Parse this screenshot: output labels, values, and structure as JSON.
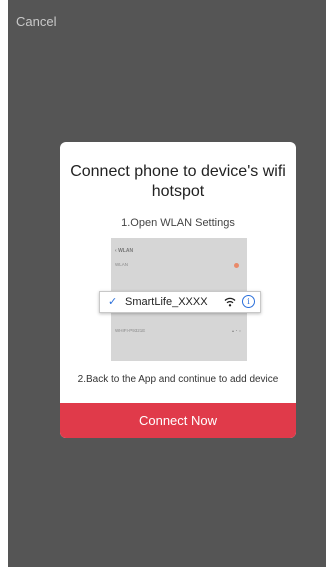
{
  "header": {
    "cancel_label": "Cancel"
  },
  "modal": {
    "title": "Connect phone to device's wifi hotspot",
    "step1": "1.Open WLAN Settings",
    "step2": "2.Back to the App and continue to add device",
    "connect_label": "Connect Now"
  },
  "wlan_screenshot": {
    "header": "WLAN",
    "rows": [
      "WLAN",
      "",
      "",
      "",
      "WHIFI-P9321E"
    ],
    "selected_network": {
      "ssid": "SmartLife_XXXX",
      "check_icon": "check-icon",
      "wifi_icon": "wifi-icon",
      "info_icon": "info-icon"
    }
  },
  "colors": {
    "overlay": "#555555",
    "accent_button": "#e03a4a",
    "link_blue": "#2a6fdb"
  }
}
